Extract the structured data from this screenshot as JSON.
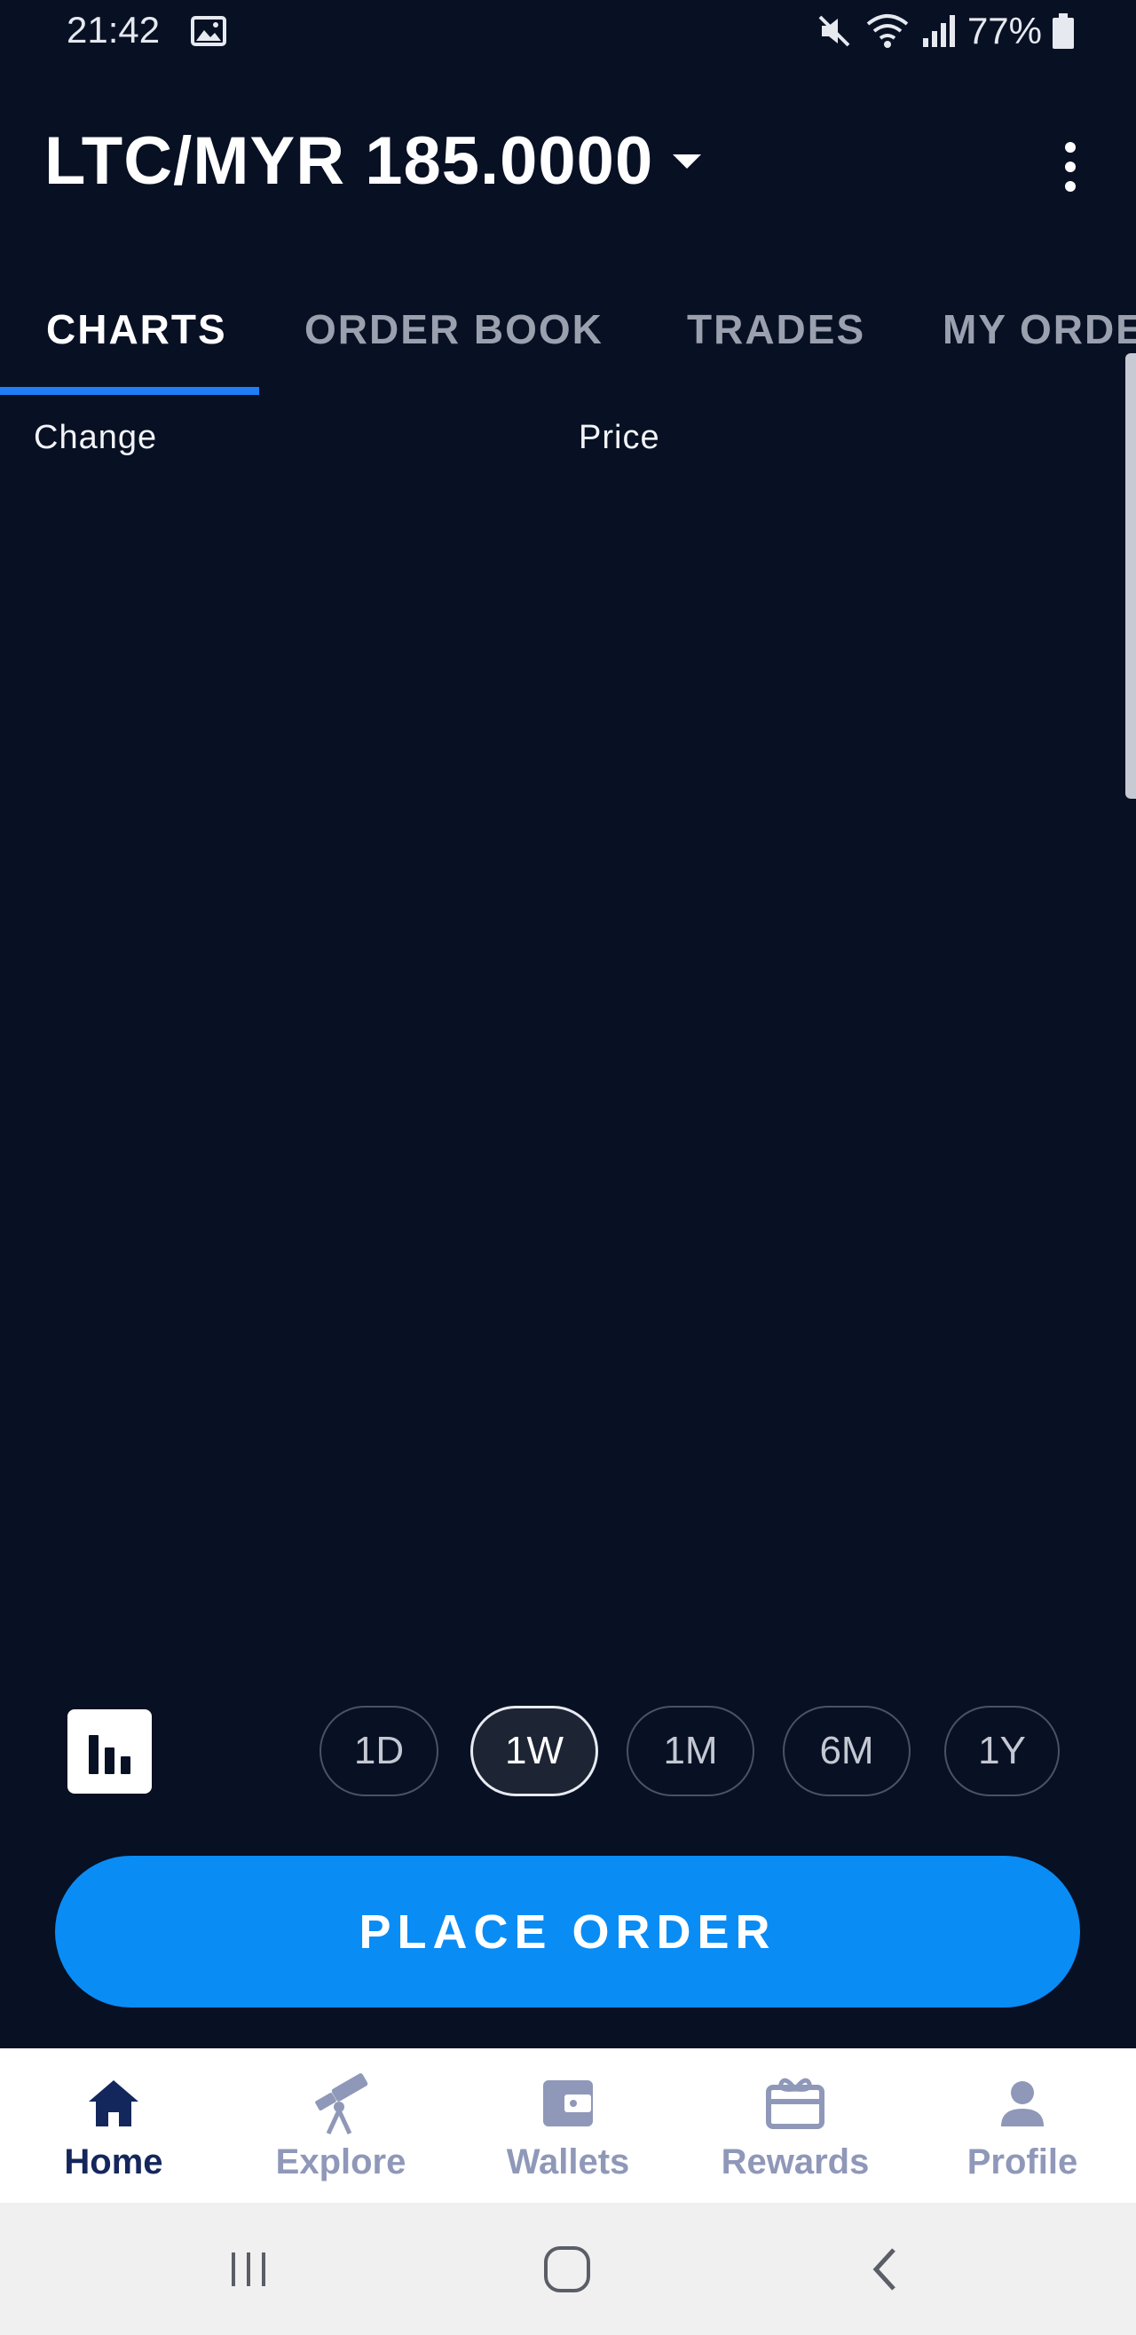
{
  "status_bar": {
    "time": "21:42",
    "battery": "77%",
    "icons": [
      "gallery-icon",
      "mute-icon",
      "wifi-icon",
      "signal-icon",
      "battery-icon"
    ]
  },
  "header": {
    "pair": "LTC/MYR",
    "price": "185.0000",
    "dropdown_icon": "caret-down-icon",
    "menu_icon": "more-vertical-icon"
  },
  "tabs": [
    {
      "label": "CHARTS",
      "active": true
    },
    {
      "label": "ORDER BOOK",
      "active": false
    },
    {
      "label": "TRADES",
      "active": false
    },
    {
      "label": "MY ORDERS",
      "active": false
    }
  ],
  "chart": {
    "change_label": "Change",
    "price_label": "Price",
    "chart_type_icon": "bar-chart-icon"
  },
  "time_ranges": [
    {
      "label": "1D",
      "active": false
    },
    {
      "label": "1W",
      "active": true
    },
    {
      "label": "1M",
      "active": false
    },
    {
      "label": "6M",
      "active": false
    },
    {
      "label": "1Y",
      "active": false
    }
  ],
  "place_order_label": "PLACE ORDER",
  "bottom_nav": [
    {
      "label": "Home",
      "icon": "home-icon",
      "active": true
    },
    {
      "label": "Explore",
      "icon": "telescope-icon",
      "active": false
    },
    {
      "label": "Wallets",
      "icon": "wallet-icon",
      "active": false
    },
    {
      "label": "Rewards",
      "icon": "gift-card-icon",
      "active": false
    },
    {
      "label": "Profile",
      "icon": "profile-icon",
      "active": false
    }
  ],
  "system_nav": [
    "recents-icon",
    "home-circle-icon",
    "back-icon"
  ],
  "colors": {
    "background": "#081024",
    "accent": "#0a8cf5",
    "tab_indicator": "#1f7df5",
    "nav_active": "#14275c",
    "nav_inactive": "#8f98b8"
  }
}
